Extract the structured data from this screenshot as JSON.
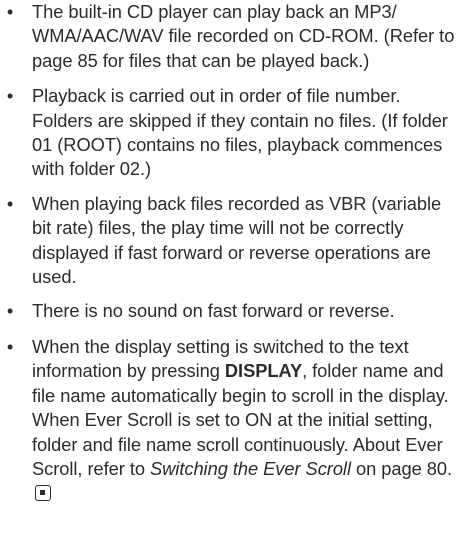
{
  "bullet_glyph": "•",
  "items": [
    {
      "text": "The built-in CD player can play back an MP3/ WMA/AAC/WAV file recorded on CD-ROM. (Refer to page 85 for files that can be played back.)"
    },
    {
      "text": "Playback is carried out in order of file number. Folders are skipped if they contain no files. (If folder 01 (ROOT) contains no files, playback commences with folder 02.)"
    },
    {
      "text": "When playing back files recorded as VBR (variable bit rate) files, the play time will not be correctly displayed if fast forward or reverse operations are used."
    },
    {
      "text": "There is no sound on fast forward or reverse."
    },
    {
      "part1": "When the display setting is switched to the text information by pressing ",
      "bold": "DISPLAY",
      "part2": ", folder name and file name automatically begin to scroll in the display. When Ever Scroll is set to ON at the initial setting, folder and file name scroll continuously. About Ever Scroll, refer to ",
      "italic": "Switching the Ever Scroll",
      "part3": " on page 80."
    }
  ],
  "end_mark_icon": "end-of-section-square-icon",
  "colors": {
    "text": "#2b2b2b",
    "background": "#ffffff"
  }
}
